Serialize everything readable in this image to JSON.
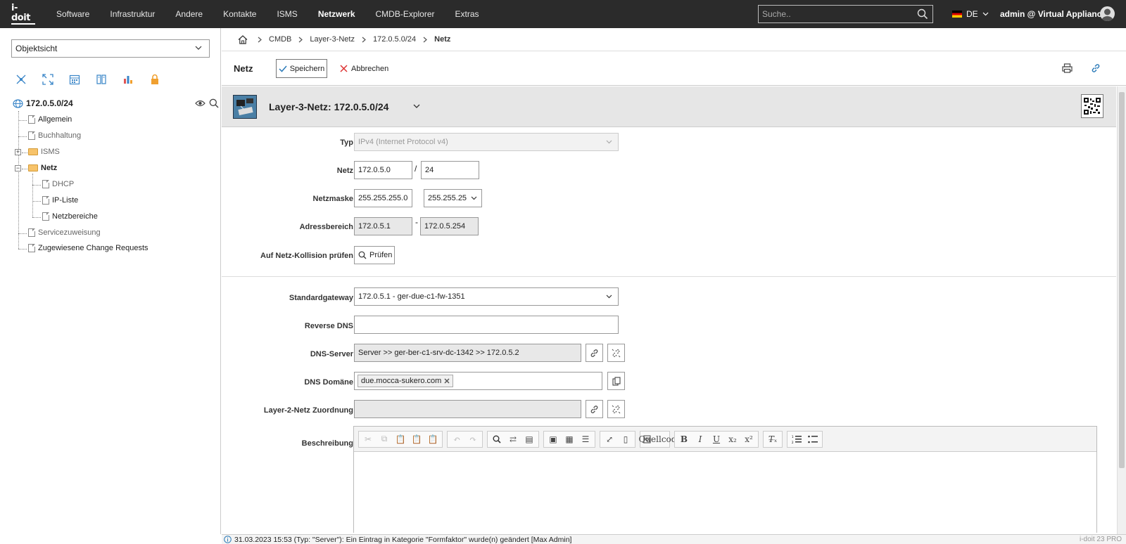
{
  "logo": "i-doit",
  "nav": [
    "Software",
    "Infrastruktur",
    "Andere",
    "Kontakte",
    "ISMS",
    "Netzwerk",
    "CMDB-Explorer",
    "Extras"
  ],
  "nav_active": "Netzwerk",
  "search": {
    "placeholder": "Suche.."
  },
  "lang": "DE",
  "user": "admin @ Virtual Appliance",
  "sidebar": {
    "view_select": "Objektsicht",
    "tree": {
      "root": "172.0.5.0/24",
      "items": [
        "Allgemein",
        "Buchhaltung",
        "ISMS",
        "Netz",
        "DHCP",
        "IP-Liste",
        "Netzbereiche",
        "Servicezuweisung",
        "Zugewiesene Change Requests"
      ]
    }
  },
  "breadcrumb": [
    "CMDB",
    "Layer-3-Netz",
    "172.0.5.0/24",
    "Netz"
  ],
  "toolbar": {
    "title": "Netz",
    "save": "Speichern",
    "cancel": "Abbrechen"
  },
  "object": {
    "title": "Layer-3-Netz: 172.0.5.0/24"
  },
  "form": {
    "typ": {
      "label": "Typ",
      "value": "IPv4 (Internet Protocol v4)"
    },
    "netz": {
      "label": "Netz",
      "address": "172.0.5.0",
      "slash": "/",
      "cidr": "24"
    },
    "netmask": {
      "label": "Netzmaske",
      "value": "255.255.255.0",
      "select": "255.255.25"
    },
    "range": {
      "label": "Adressbereich",
      "from": "172.0.5.1",
      "dash": "-",
      "to": "172.0.5.254"
    },
    "collision": {
      "label": "Auf Netz-Kollision prüfen",
      "button": "Prüfen"
    },
    "gateway": {
      "label": "Standardgateway",
      "value": "172.0.5.1 - ger-due-c1-fw-1351"
    },
    "rdns": {
      "label": "Reverse DNS",
      "value": ""
    },
    "dns_server": {
      "label": "DNS-Server",
      "value": "Server >> ger-ber-c1-srv-dc-1342 >> 172.0.5.2"
    },
    "dns_domain": {
      "label": "DNS Domäne",
      "tag": "due.mocca-sukero.com"
    },
    "layer2": {
      "label": "Layer-2-Netz Zuordnung",
      "value": ""
    },
    "description": {
      "label": "Beschreibung",
      "source_btn": "Quellcode"
    }
  },
  "status": {
    "message": "31.03.2023 15:53 (Typ: \"Server\"): Ein Eintrag in Kategorie \"Formfaktor\" wurde(n) geändert [Max Admin]",
    "version": "i-doit 23 PRO"
  }
}
